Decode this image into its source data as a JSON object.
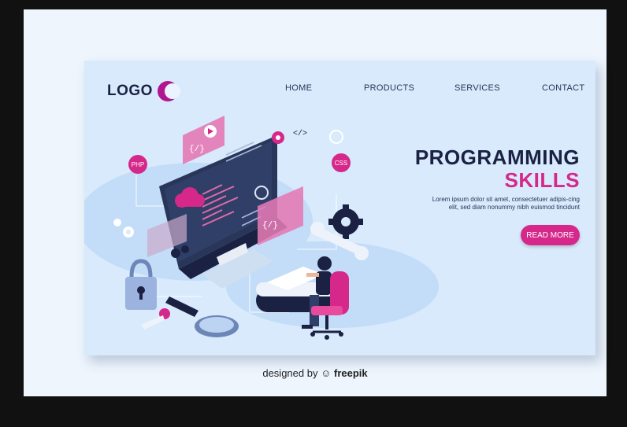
{
  "header": {
    "logo_text": "LOGO",
    "nav": [
      "HOME",
      "PRODUCTS",
      "SERVICES",
      "CONTACT"
    ]
  },
  "hero": {
    "title_line1": "PROGRAMMING",
    "title_line2": "SKILLS",
    "description": "Lorem ipsum dolor sit amet, consectetuer adipis-cing elit, sed diam nonummy nibh euismod tincidunt",
    "cta_label": "READ MORE"
  },
  "illustration": {
    "badges": [
      "PHP",
      "CSS"
    ],
    "code_glyphs": [
      "</>",
      "{/}",
      "</>"
    ],
    "icons": [
      "monitor-icon",
      "cloud-icon",
      "gear-icon",
      "wrench-icon",
      "padlock-icon",
      "key-icon",
      "magnifier-icon",
      "person-icon",
      "chair-icon",
      "keyboard-icon",
      "play-icon",
      "refresh-icon"
    ]
  },
  "footer": {
    "credit_prefix": "designed by",
    "credit_brand": "freepik"
  },
  "colors": {
    "navy": "#1a2142",
    "magenta": "#d6288a",
    "background": "#d8eafc"
  }
}
